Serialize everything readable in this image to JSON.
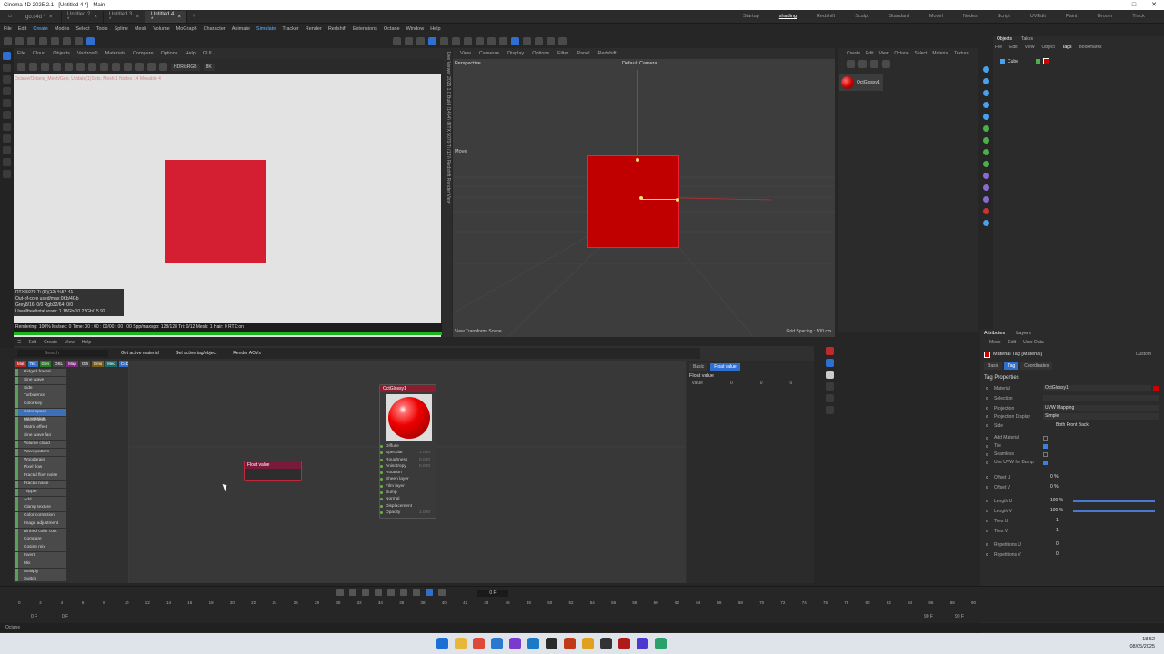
{
  "window": {
    "title": "Cinema 4D 2025.2.1 - [Untitled 4 *] - Main"
  },
  "doc_tabs": [
    "go.c4d *",
    "Untitled 2 *",
    "Untitled 3 *",
    "Untitled 4 *"
  ],
  "layouts": [
    "Startup",
    "shading",
    "Redshift",
    "Sculpt",
    "Standard",
    "Model",
    "Nodes",
    "Script",
    "UVEdit",
    "Paint",
    "Groom",
    "Track"
  ],
  "active_layout": "shading",
  "menu": [
    "File",
    "Edit",
    "Create",
    "Modes",
    "Select",
    "Tools",
    "Spline",
    "Mesh",
    "Volume",
    "MoGraph",
    "Character",
    "Animate",
    "Simulate",
    "Tracker",
    "Render",
    "Redshift",
    "Extensions",
    "Octane",
    "Window",
    "Help"
  ],
  "ipr": {
    "menu": [
      "File",
      "Cloud",
      "Objects",
      "Vectron®",
      "Materials",
      "Compare",
      "Options",
      "Help",
      "GUI"
    ],
    "mode": "HDR/sRGB",
    "mode2": "8K",
    "info_line": "Octane/Octane_Mesh/Geo, Update(1)Sets, Mesh 1 Nodes 14 Movable 4",
    "stats": [
      "RTX 5070 Ti (D)(12)   %57   41",
      "Out-of-core used/max:0Kb/4Gb",
      "Grey8/16: 0/0          Rgb32/64: 0/0",
      "Used/free/total vram: 1.18Gb/10.22Gb/15.92"
    ],
    "render_line": "Rendering: 100%  Ms/sec: 0   Time: 00 : 00 : 00/00 : 00 : 00   Spp/maxspp: 128/128   Tri: 0/12  Mesh: 1  Hair: 0    RTX:on",
    "side_label": "Live Viewer 2025.1.0 Build (1454) (RTX 5070 Ti (12)) Redshift Render View",
    "progress": 1.0
  },
  "viewport": {
    "menu": [
      "View",
      "Cameras",
      "Display",
      "Options",
      "Filter",
      "Panel",
      "Redshift"
    ],
    "perspective": "Perspective",
    "camera": "Default Camera",
    "move": "Move",
    "view_transform": "View Transform: Scene",
    "grid_spacing": "Grid Spacing : 500 cm"
  },
  "materials": {
    "menu": [
      "Create",
      "Edit",
      "View",
      "Octane",
      "Select",
      "Material",
      "Texture"
    ],
    "item": "OctGlossy1"
  },
  "objects": {
    "tabs": [
      "Objects",
      "Takes"
    ],
    "menu": [
      "File",
      "Edit",
      "View",
      "Object",
      "Tags",
      "Bookmarks"
    ],
    "item": "Cube"
  },
  "attributes": {
    "tabs": [
      "Attributes",
      "Layers"
    ],
    "mode_menu": [
      "Mode",
      "Edit",
      "User Data"
    ],
    "title": "Material Tag [Material]",
    "custom": "Custom",
    "subtabs": [
      "Basic",
      "Tag",
      "Coordinates"
    ],
    "section": "Tag Properties",
    "props": [
      {
        "name": "Material",
        "value": "OctGlossy1"
      },
      {
        "name": "Selection",
        "value": ""
      },
      {
        "name": "Projection",
        "value": "UVW Mapping"
      },
      {
        "name": "Projection Display",
        "value": "Simple"
      },
      {
        "name": "Side",
        "value": "Both          Front          Back"
      },
      {
        "name": "Add Material",
        "value": ""
      },
      {
        "name": "Tile",
        "value": ""
      },
      {
        "name": "Seamless",
        "value": ""
      },
      {
        "name": "Use UVW for Bump",
        "value": ""
      },
      {
        "name": "Offset U",
        "value": "0 %"
      },
      {
        "name": "Offset V",
        "value": "0 %"
      },
      {
        "name": "Length U",
        "value": "100 %"
      },
      {
        "name": "Length V",
        "value": "100 %"
      },
      {
        "name": "Tiles U",
        "value": "1"
      },
      {
        "name": "Tiles V",
        "value": "1"
      },
      {
        "name": "Repetitions U",
        "value": "0"
      },
      {
        "name": "Repetitions V",
        "value": "0"
      }
    ]
  },
  "node_editor": {
    "menu": [
      "Edit",
      "Create",
      "View",
      "Help"
    ],
    "search_placeholder": "Search",
    "buttons": [
      "Get active material",
      "Get active tag/object",
      "Render AOVs"
    ],
    "categories": [
      "Mat",
      "Tex",
      "Gen",
      "OSL",
      "Map",
      "Oth",
      "Ems",
      "Med",
      "C4D",
      "AOV",
      "C4D"
    ],
    "category_colors": [
      "#b02a2a",
      "#2f6fd0",
      "#2a7a2a",
      "#444444",
      "#7a2a7a",
      "#444444",
      "#7a5a1a",
      "#1a6a6a",
      "#2f6fd0",
      "#444444",
      "#b02a2a"
    ],
    "node_list": [
      "Ridged fractal",
      "Sine wave",
      "Side",
      "Turbulence",
      "Color key",
      "Color space conversion",
      "Mandelbulb",
      "Matrix effect",
      "Sine wave fan",
      "Volume cloud",
      "Wave pattern",
      "Woodgrain",
      "Pixel flow",
      "Fractal flow noise",
      "Fractal noise",
      "Tripper",
      "Add",
      "Clamp texture",
      "Color correction",
      "Image adjustment",
      "Binned color corr.",
      "Compare",
      "Cosine mix",
      "Invert",
      "Mix",
      "Multiply",
      "Switch"
    ],
    "selected_node": "Color space conversion",
    "float_node": "Float value",
    "oct_node": {
      "title": "OctGlossy1",
      "pins": [
        {
          "name": "Diffuse",
          "value": ""
        },
        {
          "name": "Specular",
          "value": "1.000"
        },
        {
          "name": "Roughness",
          "value": "0.000"
        },
        {
          "name": "Anisotropy",
          "value": "0.000"
        },
        {
          "name": "Rotation",
          "value": ""
        },
        {
          "name": "Sheen layer",
          "value": ""
        },
        {
          "name": "Film layer",
          "value": ""
        },
        {
          "name": "Bump",
          "value": ""
        },
        {
          "name": "Normal",
          "value": ""
        },
        {
          "name": "Displacement",
          "value": ""
        },
        {
          "name": "Opacity",
          "value": "1.000"
        }
      ]
    },
    "inspector": {
      "tabs": [
        "Basic",
        "Float value"
      ],
      "title": "Float value",
      "label": "value",
      "values": [
        "0",
        "0",
        "0"
      ]
    }
  },
  "timeline": {
    "frame": "0 F",
    "ticks": [
      "0",
      "2",
      "4",
      "6",
      "8",
      "10",
      "12",
      "14",
      "16",
      "18",
      "20",
      "22",
      "24",
      "26",
      "28",
      "30",
      "32",
      "34",
      "36",
      "38",
      "40",
      "42",
      "44",
      "46",
      "48",
      "50",
      "52",
      "54",
      "56",
      "58",
      "60",
      "62",
      "64",
      "66",
      "68",
      "70",
      "72",
      "74",
      "76",
      "78",
      "80",
      "82",
      "84",
      "86",
      "88",
      "90"
    ],
    "start": "0 F",
    "start2": "0 F",
    "end": "90 F",
    "end2": "90 F"
  },
  "status": "Octane",
  "clock": {
    "time": "18:52",
    "date": "08/05/2025"
  }
}
